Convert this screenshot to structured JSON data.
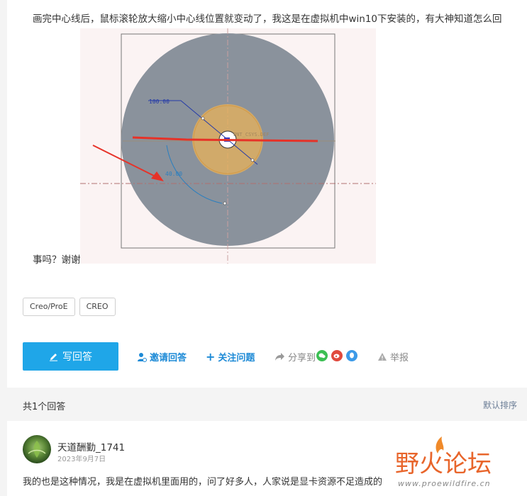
{
  "question": {
    "text_line1": "画完中心线后，鼠标滚轮放大缩小中心线位置就变动了，我这是在虚拟机中win10下安装的，有大神知道怎么回",
    "text_line2": "事吗？谢谢"
  },
  "cad_image": {
    "dimension_length": "100.00",
    "dimension_angle": "40.00",
    "point_label": "PNT_CSYS.DEF"
  },
  "tags": [
    "Creo/ProE",
    "CREO"
  ],
  "actions": {
    "write_answer": "写回答",
    "invite": "邀请回答",
    "follow": "关注问题",
    "share": "分享到",
    "report": "举报"
  },
  "answers_header": {
    "count": "共1个回答",
    "sort": "默认排序"
  },
  "answer": {
    "username": "天道酬勤_1741",
    "date": "2023年9月7日",
    "content": "我的也是这种情况，我是在虚拟机里面用的，问了好多人，人家说是显卡资源不足造成的"
  },
  "watermark": {
    "title": "野火论坛",
    "url": "www.proewildfire.cn"
  },
  "colors": {
    "accent": "#1fa6e8",
    "link": "#1d8ad6",
    "wechat": "#3bbf53",
    "weibo": "#e0493d",
    "qq": "#3c9ae8"
  }
}
